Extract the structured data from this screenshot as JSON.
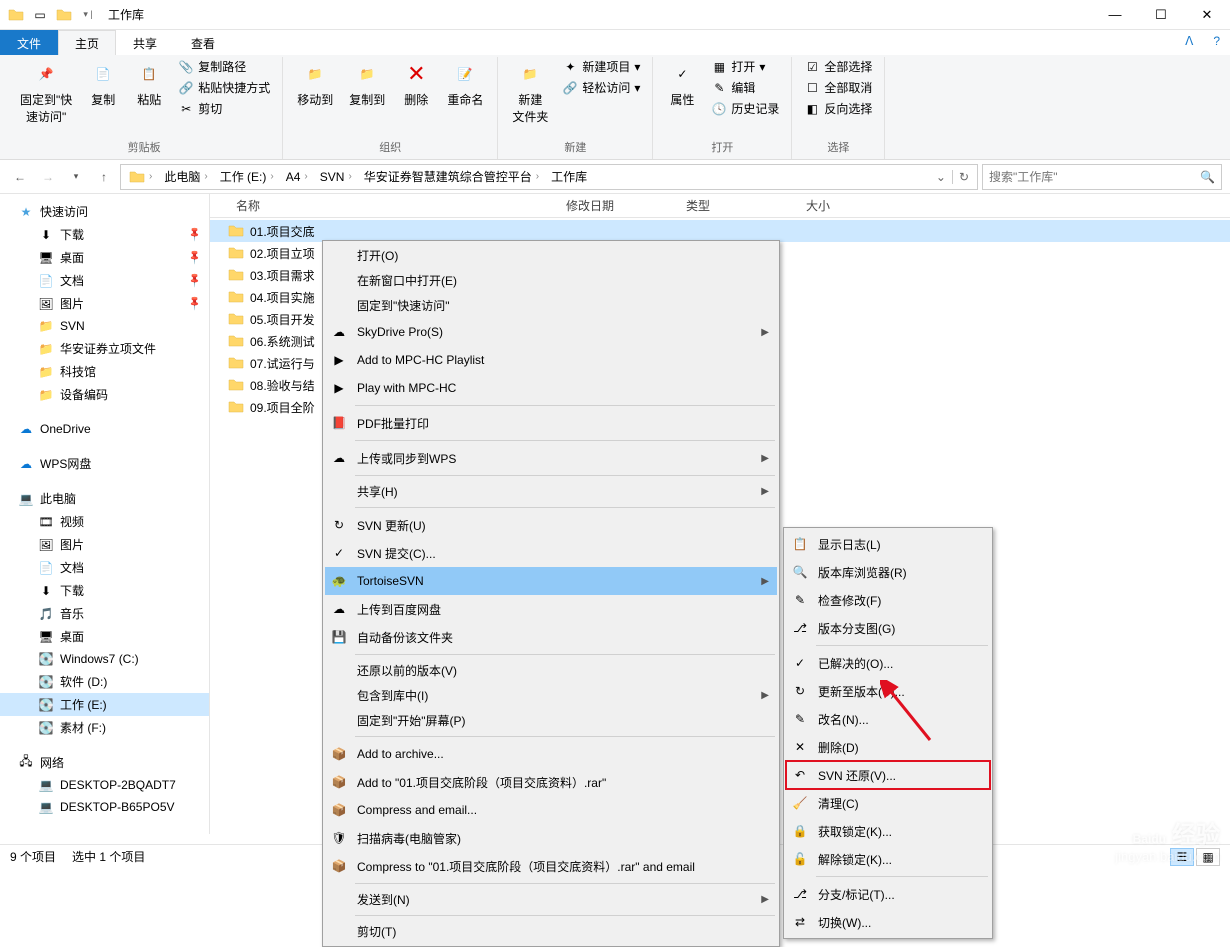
{
  "window": {
    "title": "工作库"
  },
  "tabs": {
    "file": "文件",
    "home": "主页",
    "share": "共享",
    "view": "查看"
  },
  "ribbon": {
    "pin": "固定到\"快\n速访问\"",
    "copy": "复制",
    "paste": "粘贴",
    "copyPath": "复制路径",
    "pasteShortcut": "粘贴快捷方式",
    "cut": "剪切",
    "clipboard": "剪贴板",
    "moveTo": "移动到",
    "copyTo": "复制到",
    "delete": "删除",
    "rename": "重命名",
    "organize": "组织",
    "newFolder": "新建\n文件夹",
    "newItem": "新建项目",
    "easyAccess": "轻松访问",
    "new": "新建",
    "properties": "属性",
    "open": "打开",
    "edit": "编辑",
    "history": "历史记录",
    "openGroup": "打开",
    "selectAll": "全部选择",
    "selectNone": "全部取消",
    "invertSel": "反向选择",
    "select": "选择"
  },
  "breadcrumb": [
    "此电脑",
    "工作 (E:)",
    "A4",
    "SVN",
    "华安证券智慧建筑综合管控平台",
    "工作库"
  ],
  "search": {
    "placeholder": "搜索\"工作库\""
  },
  "sidebar": {
    "quick": "快速访问",
    "quickItems": [
      {
        "label": "下载",
        "icon": "download",
        "pin": true
      },
      {
        "label": "桌面",
        "icon": "desktop",
        "pin": true
      },
      {
        "label": "文档",
        "icon": "doc",
        "pin": true
      },
      {
        "label": "图片",
        "icon": "pic",
        "pin": true
      },
      {
        "label": "SVN",
        "icon": "folder",
        "pin": false
      },
      {
        "label": "华安证券立项文件",
        "icon": "folder",
        "pin": false
      },
      {
        "label": "科技馆",
        "icon": "folder",
        "pin": false
      },
      {
        "label": "设备编码",
        "icon": "folder",
        "pin": false
      }
    ],
    "onedrive": "OneDrive",
    "wps": "WPS网盘",
    "thispc": "此电脑",
    "pcItems": [
      {
        "label": "视频",
        "icon": "video"
      },
      {
        "label": "图片",
        "icon": "pic"
      },
      {
        "label": "文档",
        "icon": "doc"
      },
      {
        "label": "下载",
        "icon": "download"
      },
      {
        "label": "音乐",
        "icon": "music"
      },
      {
        "label": "桌面",
        "icon": "desktop"
      },
      {
        "label": "Windows7 (C:)",
        "icon": "drive"
      },
      {
        "label": "软件 (D:)",
        "icon": "drive"
      },
      {
        "label": "工作 (E:)",
        "icon": "drive",
        "selected": true
      },
      {
        "label": "素材 (F:)",
        "icon": "drive"
      }
    ],
    "network": "网络",
    "netItems": [
      {
        "label": "DESKTOP-2BQADT7"
      },
      {
        "label": "DESKTOP-B65PO5V"
      }
    ]
  },
  "columns": {
    "name": "名称",
    "date": "修改日期",
    "type": "类型",
    "size": "大小"
  },
  "files": [
    {
      "name": "01.项目交底",
      "selected": true
    },
    {
      "name": "02.项目立项"
    },
    {
      "name": "03.项目需求"
    },
    {
      "name": "04.项目实施"
    },
    {
      "name": "05.项目开发"
    },
    {
      "name": "06.系统测试"
    },
    {
      "name": "07.试运行与"
    },
    {
      "name": "08.验收与结"
    },
    {
      "name": "09.项目全阶"
    }
  ],
  "status": {
    "count": "9 个项目",
    "selected": "选中 1 个项目"
  },
  "contextMenu1": [
    {
      "label": "打开(O)",
      "noicon": true
    },
    {
      "label": "在新窗口中打开(E)",
      "noicon": true
    },
    {
      "label": "固定到\"快速访问\"",
      "noicon": true
    },
    {
      "label": "SkyDrive Pro(S)",
      "icon": "cloud",
      "arrow": true
    },
    {
      "label": "Add to MPC-HC Playlist",
      "icon": "mpc"
    },
    {
      "label": "Play with MPC-HC",
      "icon": "mpc"
    },
    {
      "sep": true
    },
    {
      "label": "PDF批量打印",
      "icon": "pdf"
    },
    {
      "sep": true
    },
    {
      "label": "上传或同步到WPS",
      "icon": "wps",
      "arrow": true
    },
    {
      "sep": true
    },
    {
      "label": "共享(H)",
      "noicon": true,
      "arrow": true
    },
    {
      "sep": true
    },
    {
      "label": "SVN 更新(U)",
      "icon": "svn-up"
    },
    {
      "label": "SVN 提交(C)...",
      "icon": "svn-commit"
    },
    {
      "label": "TortoiseSVN",
      "icon": "tortoise",
      "arrow": true,
      "hover": true
    },
    {
      "label": "上传到百度网盘",
      "icon": "baidu"
    },
    {
      "label": "自动备份该文件夹",
      "icon": "backup"
    },
    {
      "sep": true
    },
    {
      "label": "还原以前的版本(V)",
      "noicon": true
    },
    {
      "label": "包含到库中(I)",
      "noicon": true,
      "arrow": true
    },
    {
      "label": "固定到\"开始\"屏幕(P)",
      "noicon": true
    },
    {
      "sep": true
    },
    {
      "label": "Add to archive...",
      "icon": "rar"
    },
    {
      "label": "Add to \"01.项目交底阶段（项目交底资料）.rar\"",
      "icon": "rar"
    },
    {
      "label": "Compress and email...",
      "icon": "rar"
    },
    {
      "label": "扫描病毒(电脑管家)",
      "icon": "shield"
    },
    {
      "label": "Compress to \"01.项目交底阶段（项目交底资料）.rar\" and email",
      "icon": "rar"
    },
    {
      "sep": true
    },
    {
      "label": "发送到(N)",
      "noicon": true,
      "arrow": true
    },
    {
      "sep": true
    },
    {
      "label": "剪切(T)",
      "noicon": true
    }
  ],
  "contextMenu2": [
    {
      "label": "显示日志(L)",
      "icon": "log"
    },
    {
      "label": "版本库浏览器(R)",
      "icon": "browse"
    },
    {
      "label": "检查修改(F)",
      "icon": "check"
    },
    {
      "label": "版本分支图(G)",
      "icon": "graph"
    },
    {
      "sep": true
    },
    {
      "label": "已解决的(O)...",
      "icon": "resolve"
    },
    {
      "label": "更新至版本(U)...",
      "icon": "update"
    },
    {
      "label": "改名(N)...",
      "icon": "rename"
    },
    {
      "label": "删除(D)",
      "icon": "delete"
    },
    {
      "label": "SVN 还原(V)...",
      "icon": "revert",
      "highlighted": true
    },
    {
      "label": "清理(C)",
      "icon": "clean"
    },
    {
      "label": "获取锁定(K)...",
      "icon": "lock"
    },
    {
      "label": "解除锁定(K)...",
      "icon": "unlock"
    },
    {
      "sep": true
    },
    {
      "label": "分支/标记(T)...",
      "icon": "branch"
    },
    {
      "label": "切换(W)...",
      "icon": "switch"
    }
  ],
  "watermark": {
    "brand": "Baidu",
    "sub1": "经验",
    "sub2": "jingyan.baidu.com"
  }
}
